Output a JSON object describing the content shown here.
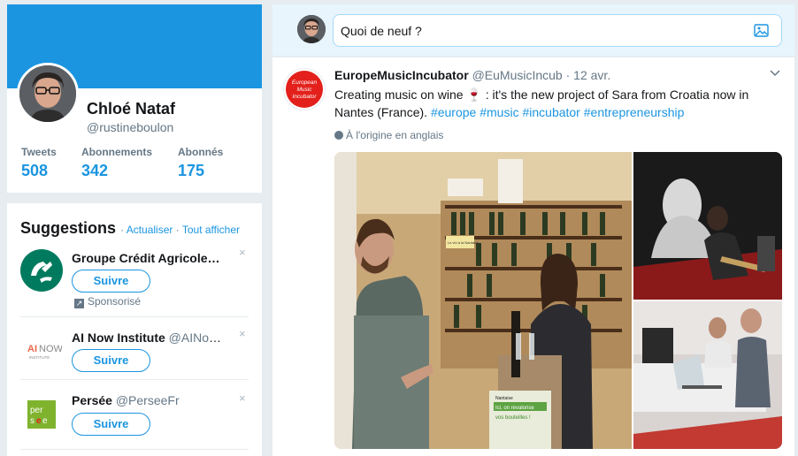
{
  "profile": {
    "name": "Chloé Nataf",
    "handle": "@rustineboulon",
    "stats": [
      {
        "label": "Tweets",
        "value": "508"
      },
      {
        "label": "Abonnements",
        "value": "342"
      },
      {
        "label": "Abonnés",
        "value": "175"
      }
    ]
  },
  "suggestions": {
    "title": "Suggestions",
    "refresh_link": "Actualiser",
    "show_all_link": "Tout afficher",
    "separator": "·",
    "items": [
      {
        "name": "Groupe Crédit Agricole…",
        "handle": "",
        "button": "Suivre",
        "sponsored": "Sponsorisé",
        "close": "×"
      },
      {
        "name": "AI Now Institute",
        "handle": "@AINow…",
        "button": "Suivre",
        "close": "×"
      },
      {
        "name": "Persée",
        "handle": "@PerseeFr",
        "button": "Suivre",
        "close": "×"
      }
    ]
  },
  "composer": {
    "placeholder": "Quoi de neuf ?"
  },
  "tweet": {
    "author": "EuropeMusicIncubator",
    "handle": "@EuMusicIncub",
    "date": "· 12 avr.",
    "text_main": "Creating music on wine 🍷 : it's the new project of Sara from Croatia now in Nantes (France).",
    "hashtags": [
      "#europe",
      "#music",
      "#incubator",
      "#entrepreneurship"
    ],
    "translate_label": "À l'origine en anglais",
    "avatar_text": [
      "European",
      "Music",
      "Incubator"
    ]
  },
  "photo_text": {
    "sign": "Le vin à la Nantaise",
    "crate_brand": "Nantaise",
    "crate_line1": "Ici, on revalorise",
    "crate_line2": "vos bouteilles !"
  },
  "colors": {
    "accent": "#1b95e0",
    "banner": "#1b95e0",
    "background": "#e6ecf0",
    "credit_agricole": "#007a5e",
    "eu_music_red": "#e3201b"
  }
}
